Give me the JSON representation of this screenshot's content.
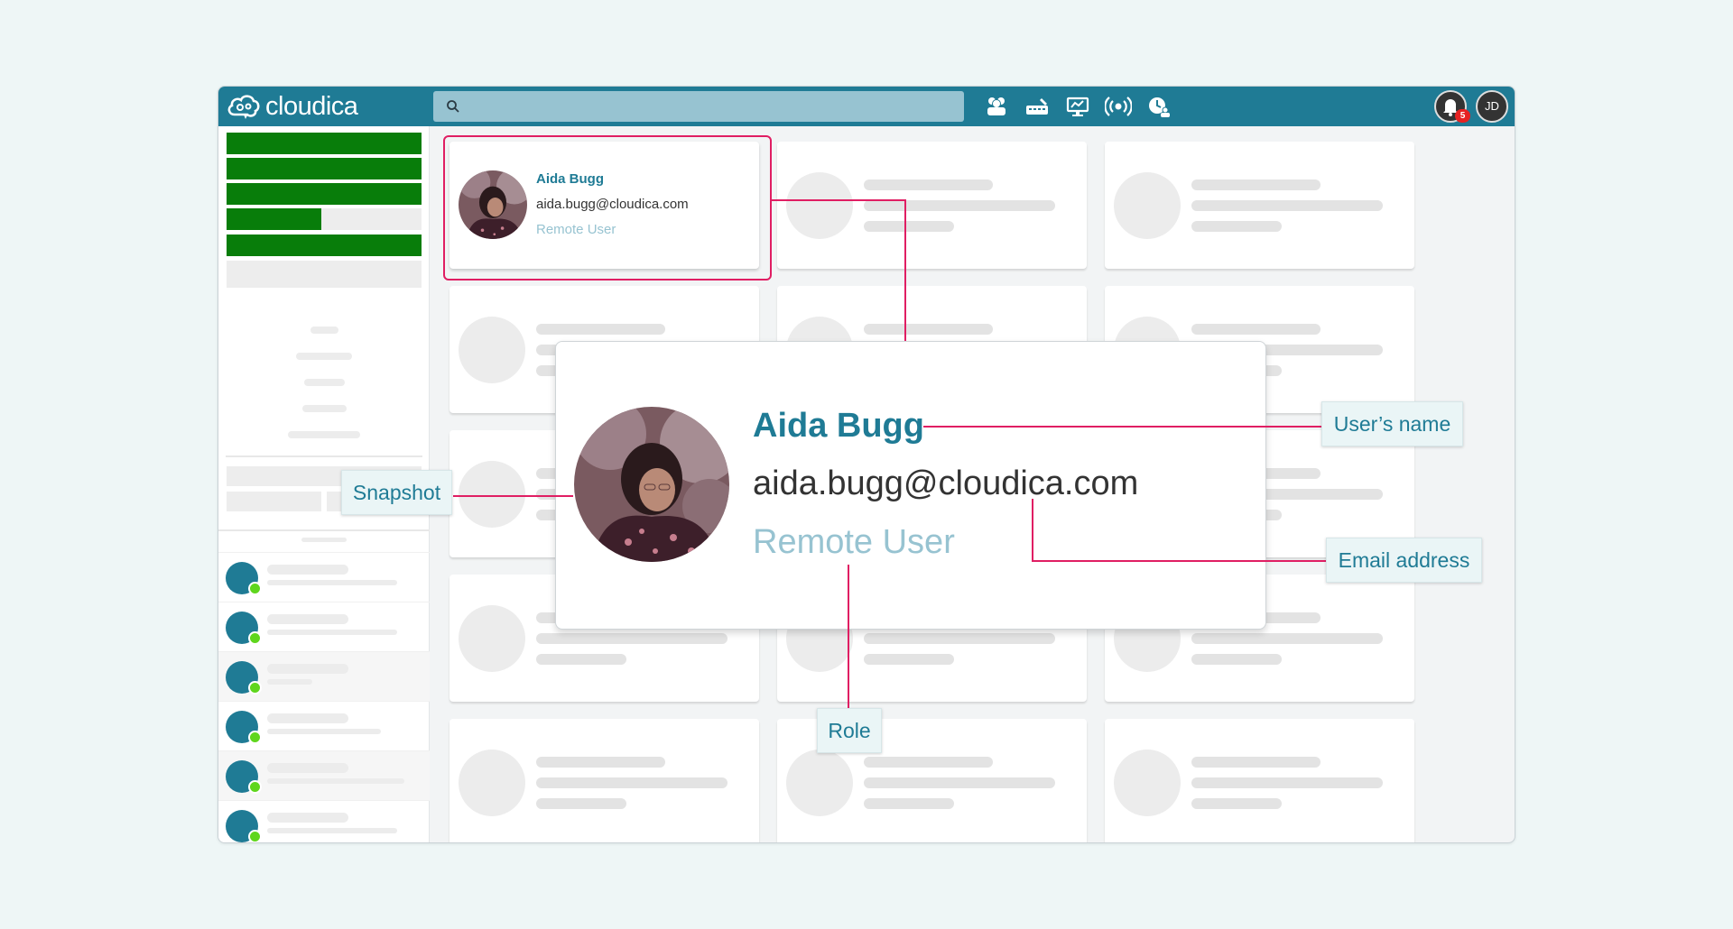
{
  "app": {
    "logo_text": "cloudica",
    "search_placeholder": "",
    "header_icons": [
      "users-icon",
      "keyboard-icon",
      "monitor-icon",
      "broadcast-icon",
      "clock-user-icon"
    ],
    "notification_count": "5",
    "user_initials": "JD"
  },
  "user_card": {
    "name": "Aida Bugg",
    "email": "aida.bugg@cloudica.com",
    "role": "Remote User"
  },
  "callouts": {
    "name": "User’s name",
    "snapshot": "Snapshot",
    "email": "Email address",
    "role": "Role"
  },
  "colors": {
    "brand": "#1f7b95",
    "highlight": "#e01e63",
    "sidebar_green": "#087d0a",
    "role_text": "#97c3d1",
    "online": "#5fd61d"
  }
}
